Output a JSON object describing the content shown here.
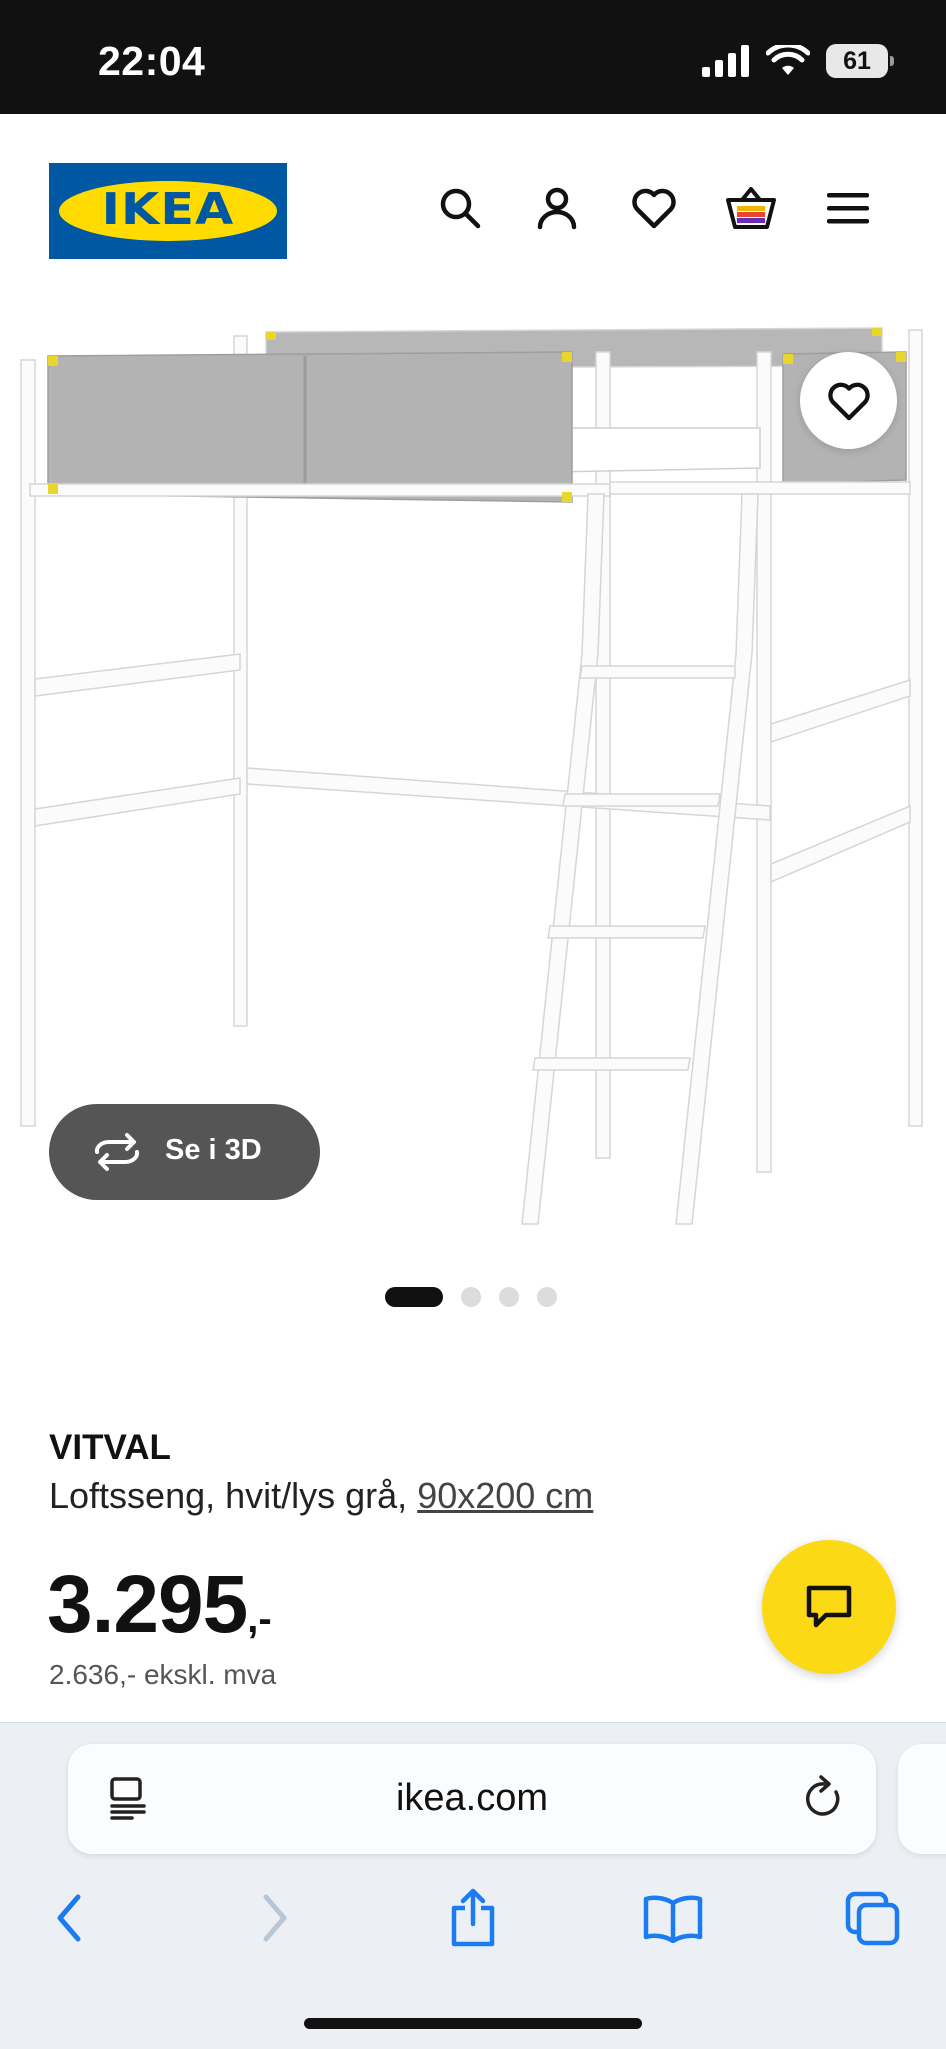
{
  "status_bar": {
    "time": "22:04",
    "battery": "61"
  },
  "header": {
    "logo_text": "IKEA"
  },
  "gallery": {
    "view_3d_label": "Se i 3D",
    "slide_count": 4,
    "active_slide": 1
  },
  "product": {
    "name": "VITVAL",
    "description": "Loftsseng, hvit/lys grå, ",
    "size_link": "90x200 cm",
    "price": "3.295",
    "price_suffix": ",-",
    "price_ex_vat": "2.636,- ekskl. mva"
  },
  "browser": {
    "url": "ikea.com"
  },
  "colors": {
    "ikea_blue": "#0058a3",
    "ikea_yellow": "#ffdb00",
    "chat_yellow": "#fbd914",
    "safari_blue": "#1a7cf0"
  }
}
